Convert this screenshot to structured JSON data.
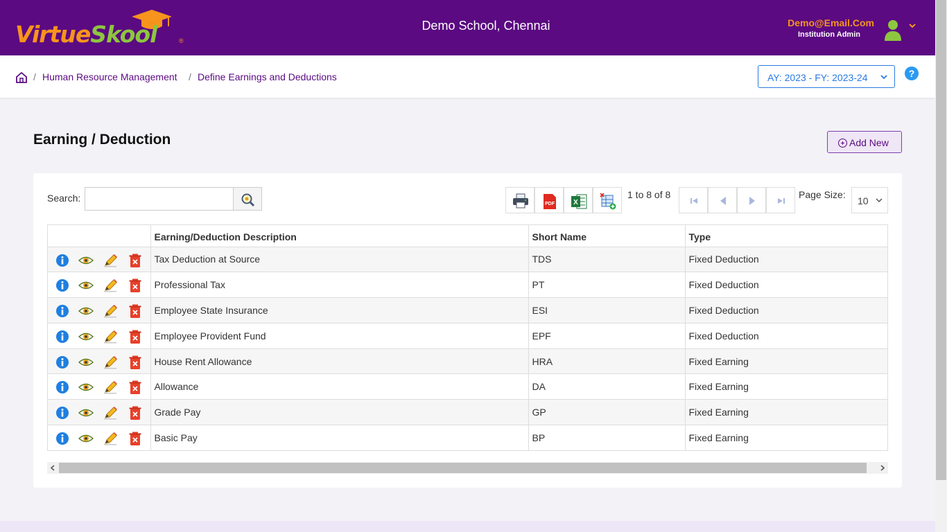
{
  "header": {
    "brand_part1": "Virtue",
    "brand_part2": "Skool",
    "brand_mark": "®",
    "school_name": "Demo School, Chennai",
    "user_email": "Demo@Email.Com",
    "user_role": "Institution Admin"
  },
  "breadcrumb": {
    "items": [
      "Human Resource Management",
      "Define Earnings and Deductions"
    ],
    "separator": "/"
  },
  "year_selector": {
    "value": "AY: 2023 - FY: 2023-24"
  },
  "help": {
    "label": "?"
  },
  "page": {
    "title": "Earning / Deduction",
    "add_button": "Add New"
  },
  "search": {
    "label": "Search:",
    "value": ""
  },
  "pager": {
    "summary": "1 to 8 of 8",
    "page_size_label": "Page Size:",
    "page_size": "10"
  },
  "table": {
    "columns": [
      "",
      "Earning/Deduction Description",
      "Short Name",
      "Type"
    ],
    "rows": [
      {
        "description": "Tax Deduction at Source",
        "short": "TDS",
        "type": "Fixed Deduction"
      },
      {
        "description": "Professional Tax",
        "short": "PT",
        "type": "Fixed Deduction"
      },
      {
        "description": "Employee State Insurance",
        "short": "ESI",
        "type": "Fixed Deduction"
      },
      {
        "description": "Employee Provident Fund",
        "short": "EPF",
        "type": "Fixed Deduction"
      },
      {
        "description": "House Rent Allowance",
        "short": "HRA",
        "type": "Fixed Earning"
      },
      {
        "description": "Allowance",
        "short": "DA",
        "type": "Fixed Earning"
      },
      {
        "description": "Grade Pay",
        "short": "GP",
        "type": "Fixed Earning"
      },
      {
        "description": "Basic Pay",
        "short": "BP",
        "type": "Fixed Earning"
      }
    ]
  },
  "colors": {
    "header_bg": "#5b0a82",
    "brand_orange": "#f7941d",
    "brand_green": "#8dc63f",
    "link": "#5b0a82",
    "accent_blue": "#2a7ae2"
  }
}
